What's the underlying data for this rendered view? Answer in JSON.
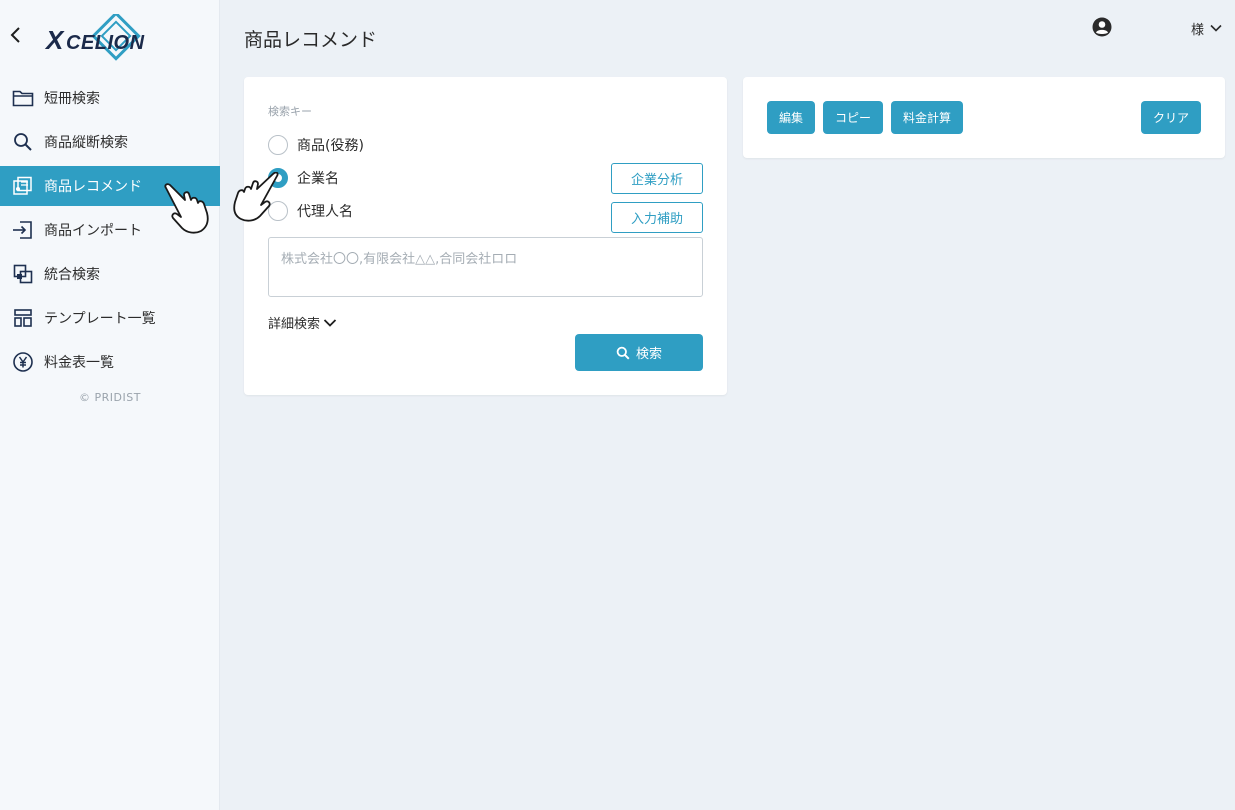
{
  "app": {
    "logo_text": "XCELION",
    "brand_color": "#2f9ec3"
  },
  "sidebar": {
    "items": [
      {
        "label": "短冊検索",
        "icon": "folder-icon"
      },
      {
        "label": "商品縦断検索",
        "icon": "search-icon"
      },
      {
        "label": "商品レコメンド",
        "icon": "recommend-icon",
        "active": true
      },
      {
        "label": "商品インポート",
        "icon": "import-icon"
      },
      {
        "label": "統合検索",
        "icon": "merge-icon"
      },
      {
        "label": "テンプレート一覧",
        "icon": "template-icon"
      },
      {
        "label": "料金表一覧",
        "icon": "yen-icon"
      }
    ],
    "copyright": "© PRIDIST"
  },
  "header": {
    "title": "商品レコメンド",
    "user_suffix": "様"
  },
  "search": {
    "section_label": "検索キー",
    "options": [
      {
        "label": "商品(役務)",
        "checked": false
      },
      {
        "label": "企業名",
        "checked": true
      },
      {
        "label": "代理人名",
        "checked": false
      }
    ],
    "company_analysis_label": "企業分析",
    "input_assist_label": "入力補助",
    "textarea_placeholder": "株式会社〇〇,有限会社△△,合同会社ロロ",
    "detail_label": "詳細検索",
    "search_button_label": "検索"
  },
  "actions": {
    "edit_label": "編集",
    "copy_label": "コピー",
    "fee_calc_label": "料金計算",
    "clear_label": "クリア"
  }
}
